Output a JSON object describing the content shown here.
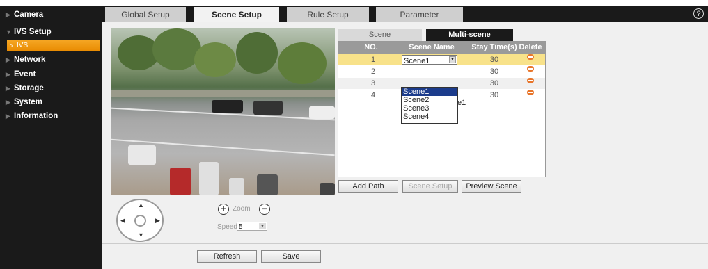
{
  "sidebar": {
    "items": [
      {
        "label": "Camera"
      },
      {
        "label": "IVS Setup"
      },
      {
        "label": "Network"
      },
      {
        "label": "Event"
      },
      {
        "label": "Storage"
      },
      {
        "label": "System"
      },
      {
        "label": "Information"
      }
    ],
    "sub_item": {
      "label": "IVS"
    }
  },
  "tabs": [
    {
      "label": "Global Setup"
    },
    {
      "label": "Scene Setup"
    },
    {
      "label": "Rule Setup"
    },
    {
      "label": "Parameter"
    }
  ],
  "help": {
    "label": "?"
  },
  "ptz": {
    "zoom_label": "Zoom",
    "speed_label": "Speed",
    "speed_value": "5"
  },
  "subtabs": {
    "scene": "Scene",
    "multi_scene": "Multi-scene"
  },
  "table": {
    "headers": {
      "no": "NO.",
      "scene_name": "Scene Name",
      "stay_time": "Stay Time(s)",
      "delete": "Delete"
    },
    "rows": [
      {
        "no": "1",
        "scene": "Scene1",
        "stay": "30"
      },
      {
        "no": "2",
        "scene": "",
        "stay": "30"
      },
      {
        "no": "3",
        "scene": "",
        "stay": "30"
      },
      {
        "no": "4",
        "scene": "",
        "stay": "30"
      }
    ]
  },
  "dropdown": {
    "options": [
      "Scene1",
      "Scene2",
      "Scene3",
      "Scene4"
    ],
    "peek": "e1"
  },
  "buttons": {
    "add_path": "Add Path",
    "scene_setup": "Scene Setup",
    "preview_scene": "Preview Scene",
    "refresh": "Refresh",
    "save": "Save"
  },
  "colors": {
    "accent": "#f5a623",
    "dark": "#1a1a1a",
    "selected_row": "#f8e28a",
    "delete": "#e8752a"
  }
}
